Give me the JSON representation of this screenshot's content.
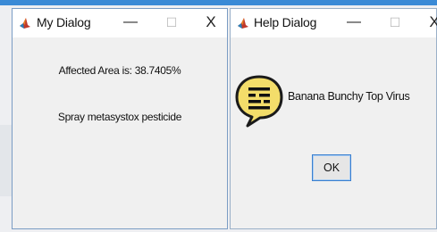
{
  "my_dialog": {
    "title": "My Dialog",
    "minimize_glyph": "—",
    "maximize_glyph": "☐",
    "close_glyph": "X",
    "affected_area_text": "Affected Area is: 38.7405%",
    "recommendation_text": "Spray metasystox pesticide"
  },
  "help_dialog": {
    "title": "Help Dialog",
    "minimize_glyph": "—",
    "maximize_glyph": "☐",
    "close_glyph": "X",
    "icon": "help-speech-bubble-icon",
    "message": "Banana Bunchy Top Virus",
    "ok_label": "OK"
  },
  "colors": {
    "dialog_background": "#f0f0f0",
    "titlebar_background": "#ffffff",
    "help_icon_fill": "#f3dd6a",
    "ok_focus_border": "#3a7fcf",
    "desktop_accent": "#3a8ad6"
  }
}
